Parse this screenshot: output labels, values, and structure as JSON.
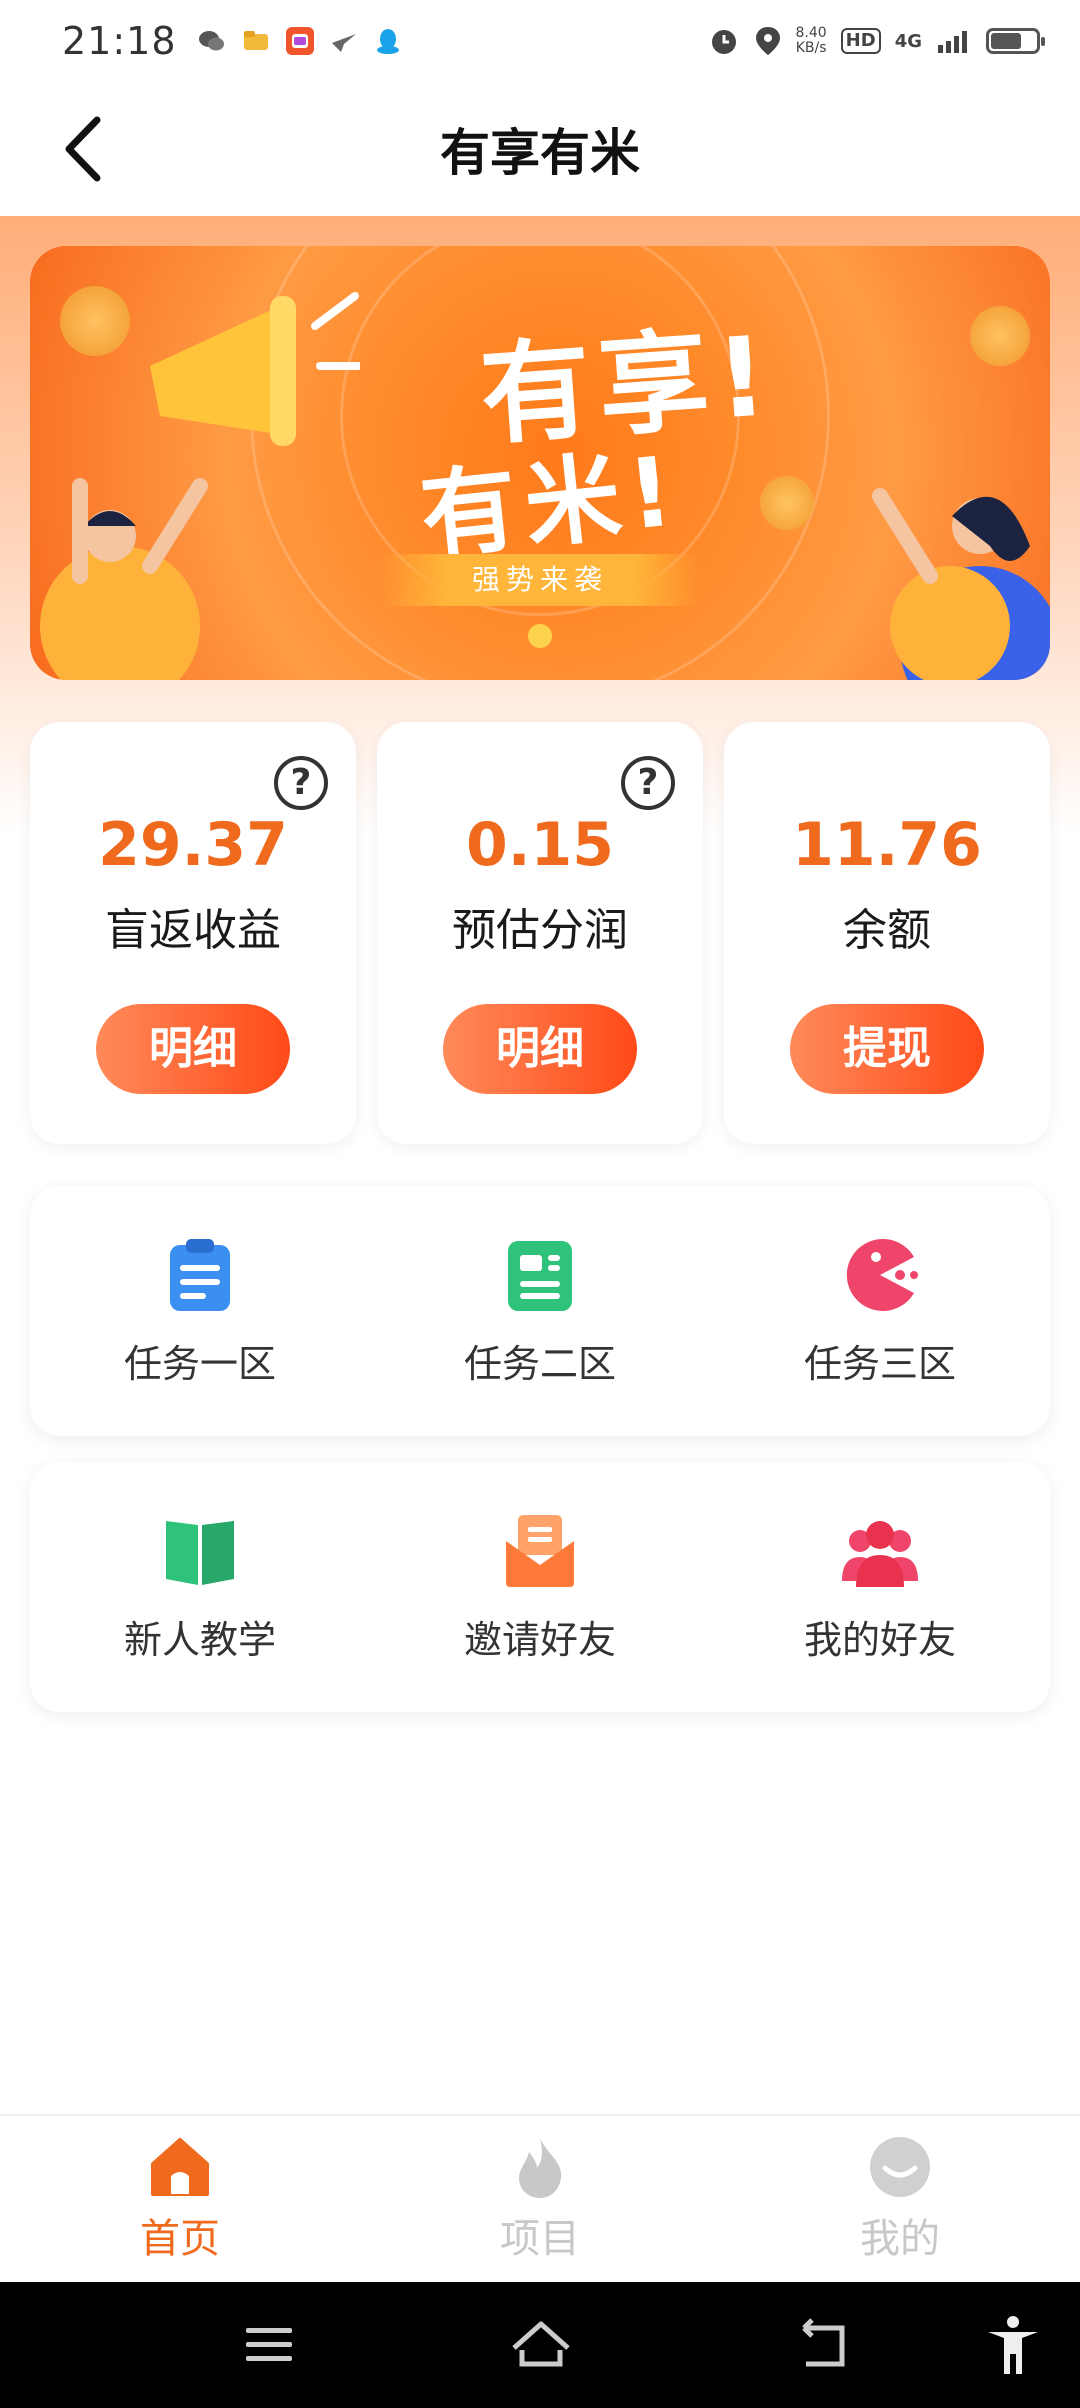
{
  "status_bar": {
    "time": "21:18",
    "speed_value": "8.40",
    "speed_unit": "KB/s",
    "hd_label": "HD",
    "network_label": "4G",
    "icons": [
      "wechat-icon",
      "folder-icon",
      "taobao-icon",
      "bird-icon",
      "qq-icon",
      "alarm-icon",
      "location-icon",
      "signal-icon",
      "battery-icon"
    ]
  },
  "header": {
    "title": "有享有米",
    "back_icon": "chevron-left-icon"
  },
  "banner": {
    "headline_1": "有享!",
    "headline_2": "有米!",
    "ribbon_text": "强势来袭",
    "colors": {
      "primary": "#ff7a1a",
      "accent": "#ffb43a"
    }
  },
  "stats": [
    {
      "value": "29.37",
      "label": "盲返收益",
      "button": "明细",
      "has_help": true
    },
    {
      "value": "0.15",
      "label": "预估分润",
      "button": "明细",
      "has_help": true
    },
    {
      "value": "11.76",
      "label": "余额",
      "button": "提现",
      "has_help": false
    }
  ],
  "help_glyph": "?",
  "tasks": [
    {
      "label": "任务一区",
      "icon": "clipboard-icon",
      "color": "#3a8ff0"
    },
    {
      "label": "任务二区",
      "icon": "document-icon",
      "color": "#2fc27a"
    },
    {
      "label": "任务三区",
      "icon": "pacman-icon",
      "color": "#f0456a"
    }
  ],
  "tools": [
    {
      "label": "新人教学",
      "icon": "book-icon",
      "color": "#2fc27a"
    },
    {
      "label": "邀请好友",
      "icon": "envelope-icon",
      "color": "#ff7a3a"
    },
    {
      "label": "我的好友",
      "icon": "users-icon",
      "color": "#f0456a"
    }
  ],
  "bottom_nav": [
    {
      "label": "首页",
      "icon": "home-icon",
      "active": true
    },
    {
      "label": "项目",
      "icon": "fire-icon",
      "active": false
    },
    {
      "label": "我的",
      "icon": "smile-icon",
      "active": false
    }
  ],
  "theme": {
    "accent": "#f06a1e",
    "inactive": "#c8c8c8"
  }
}
